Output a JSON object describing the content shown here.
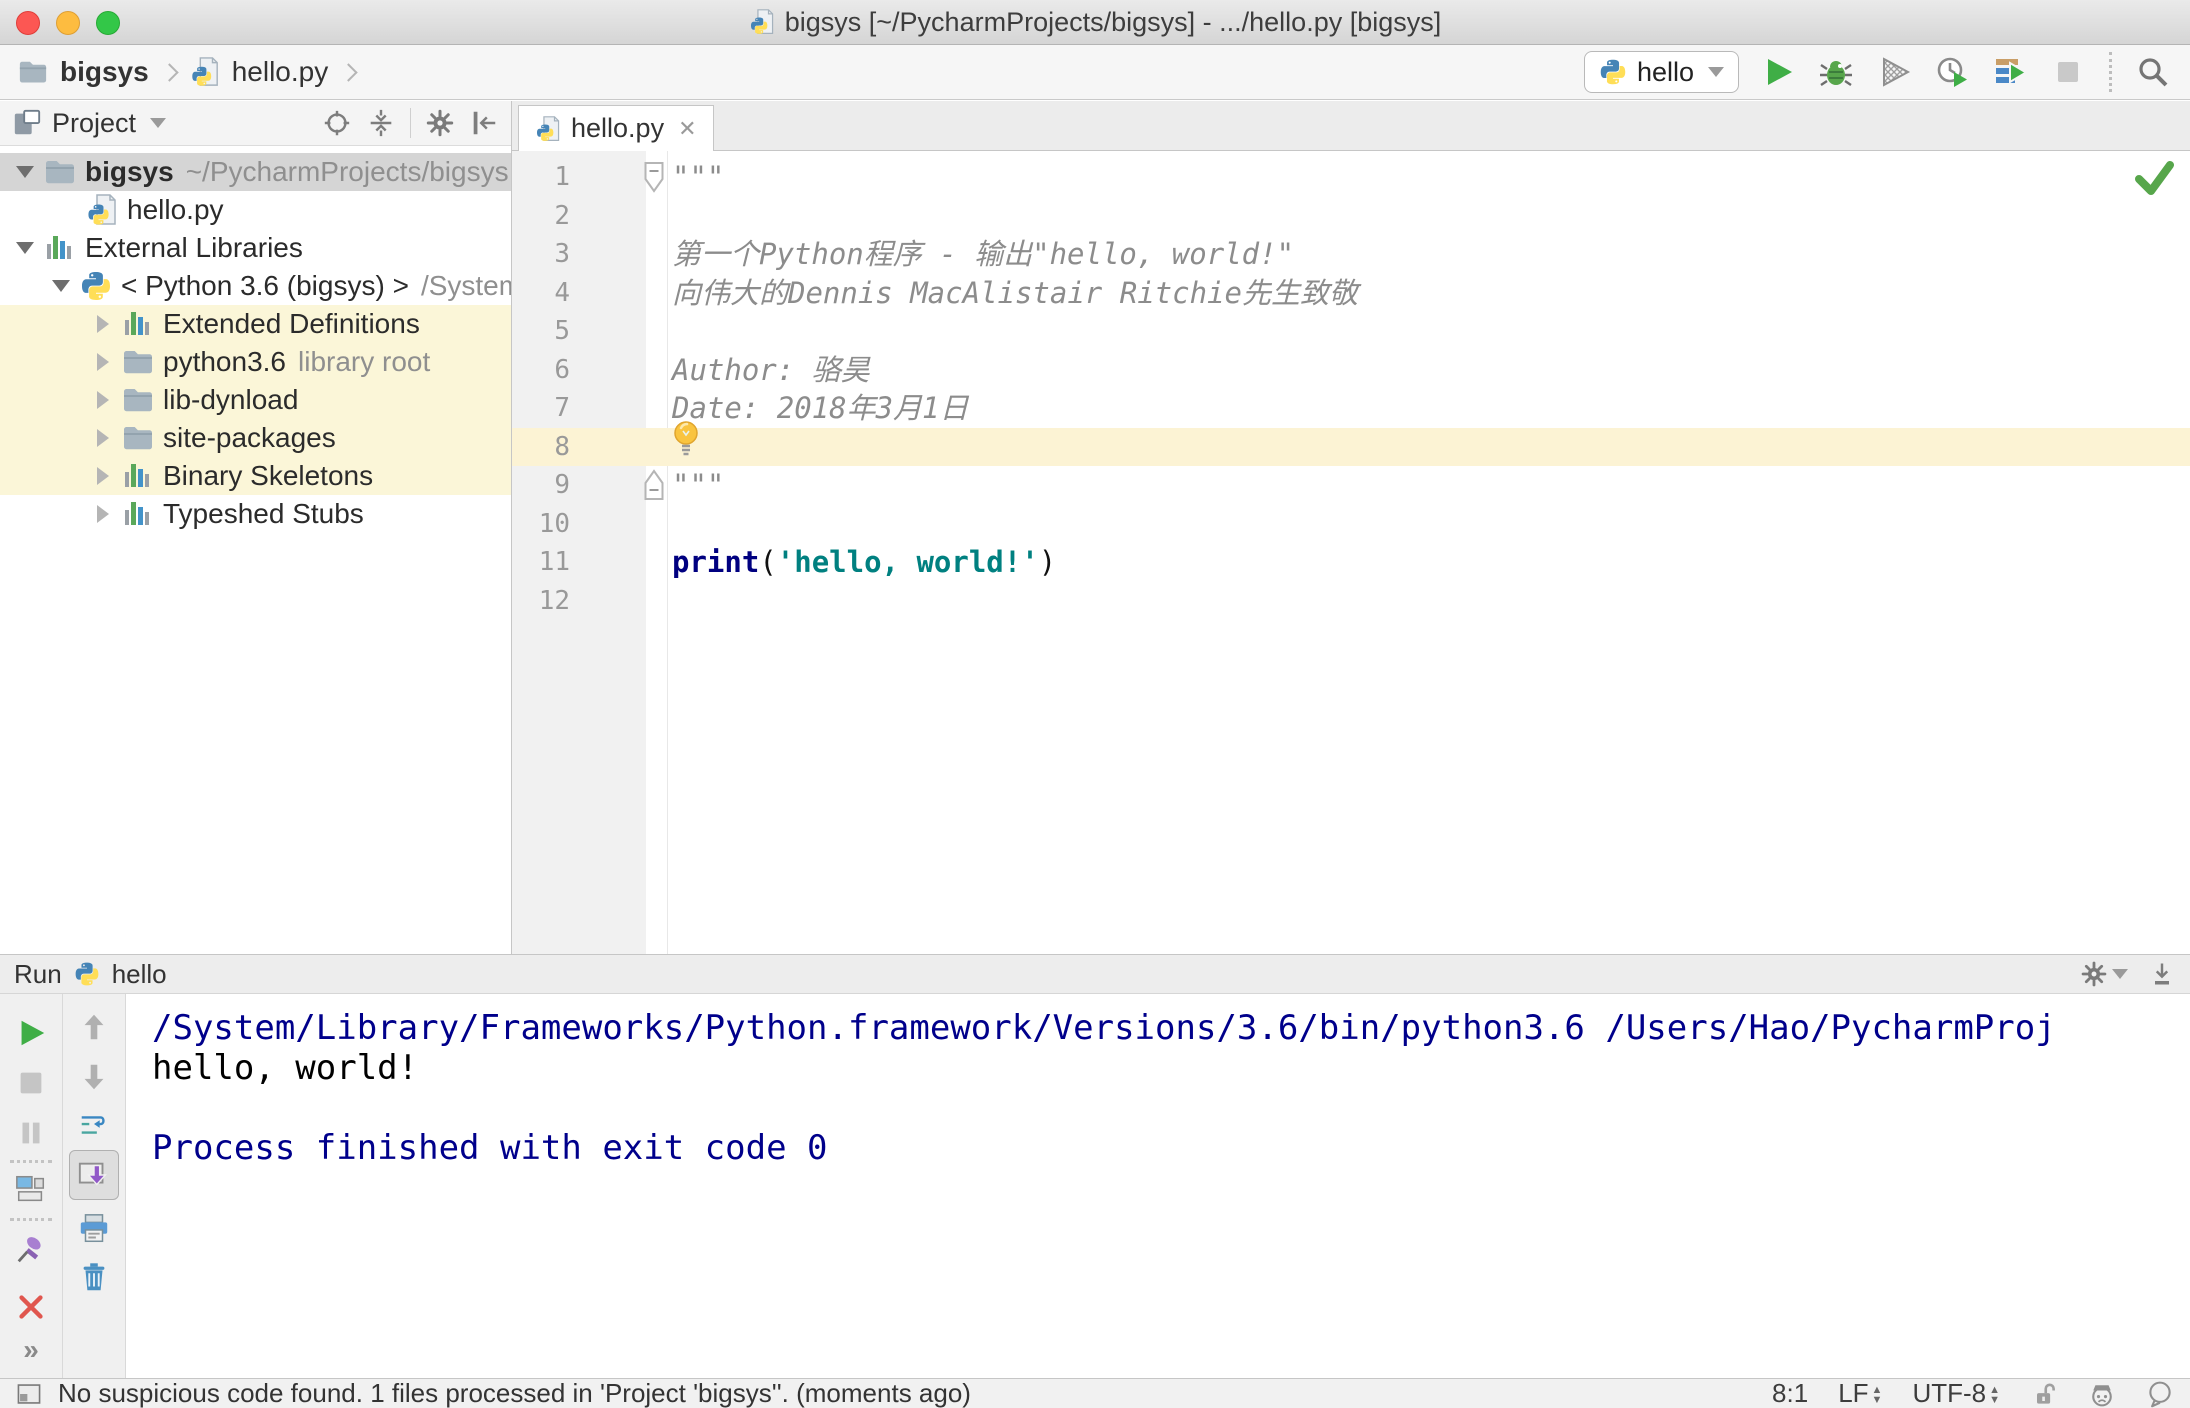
{
  "window": {
    "title": "bigsys [~/PycharmProjects/bigsys] - .../hello.py [bigsys]"
  },
  "navbar": {
    "breadcrumbs": {
      "project": "bigsys",
      "file": "hello.py"
    },
    "run_config": "hello",
    "toolbar_icons": [
      "run",
      "debug",
      "run-with-coverage",
      "profiler",
      "concurrency-diagram",
      "stop",
      "search-everywhere"
    ]
  },
  "project_panel": {
    "title": "Project",
    "toolbar_icons": [
      "locate",
      "collapse-all",
      "settings",
      "hide-panel"
    ],
    "tree": [
      {
        "label": "bigsys",
        "hint": "~/PycharmProjects/bigsys",
        "icon": "folder",
        "indent": "l0",
        "arrow": "expanded",
        "selected": true,
        "bold": true
      },
      {
        "label": "hello.py",
        "hint": "",
        "icon": "python-file",
        "indent": "file",
        "arrow": "none"
      },
      {
        "label": "External Libraries",
        "hint": "",
        "icon": "library",
        "indent": "l0",
        "arrow": "expanded"
      },
      {
        "label": "< Python 3.6 (bigsys) >",
        "hint": "/System",
        "icon": "python",
        "indent": "l1",
        "arrow": "expanded"
      },
      {
        "label": "Extended Definitions",
        "hint": "",
        "icon": "library",
        "indent": "l2",
        "arrow": "collapsed",
        "highlight": true
      },
      {
        "label": "python3.6",
        "hint": "library root",
        "icon": "folder",
        "indent": "l2",
        "arrow": "collapsed",
        "highlight": true
      },
      {
        "label": "lib-dynload",
        "hint": "",
        "icon": "folder",
        "indent": "l2",
        "arrow": "collapsed",
        "highlight": true
      },
      {
        "label": "site-packages",
        "hint": "",
        "icon": "folder",
        "indent": "l2",
        "arrow": "collapsed",
        "highlight": true
      },
      {
        "label": "Binary Skeletons",
        "hint": "",
        "icon": "library",
        "indent": "l2",
        "arrow": "collapsed",
        "highlight": true
      },
      {
        "label": "Typeshed Stubs",
        "hint": "",
        "icon": "library",
        "indent": "l2",
        "arrow": "collapsed"
      }
    ]
  },
  "editor": {
    "tab": {
      "title": "hello.py",
      "close_glyph": "✕"
    },
    "caret_line": 8,
    "bulb_line": 7,
    "inspection_status": "ok",
    "fold_markers": [
      {
        "line": 1,
        "direction": "down"
      },
      {
        "line": 9,
        "direction": "up"
      }
    ],
    "lines": [
      {
        "n": 1,
        "segments": [
          {
            "text": "\"\"\"",
            "style": "doc"
          }
        ]
      },
      {
        "n": 2,
        "segments": []
      },
      {
        "n": 3,
        "segments": [
          {
            "text": "第一个Python程序 - 输出\"hello, world!\"",
            "style": "doc"
          }
        ]
      },
      {
        "n": 4,
        "segments": [
          {
            "text": "向伟大的Dennis MacAlistair Ritchie先生致敬",
            "style": "doc"
          }
        ]
      },
      {
        "n": 5,
        "segments": []
      },
      {
        "n": 6,
        "segments": [
          {
            "text": "Author: 骆昊",
            "style": "doc"
          }
        ]
      },
      {
        "n": 7,
        "segments": [
          {
            "text": "Date: 2018年3月1日",
            "style": "doc"
          }
        ]
      },
      {
        "n": 8,
        "segments": []
      },
      {
        "n": 9,
        "segments": [
          {
            "text": "\"\"\"",
            "style": "doc"
          }
        ]
      },
      {
        "n": 10,
        "segments": []
      },
      {
        "n": 11,
        "segments": [
          {
            "text": "print",
            "style": "keyword"
          },
          {
            "text": "(",
            "style": "plain"
          },
          {
            "text": "'hello, world!'",
            "style": "string"
          },
          {
            "text": ")",
            "style": "plain"
          }
        ]
      },
      {
        "n": 12,
        "segments": []
      }
    ]
  },
  "run_panel": {
    "title": "Run",
    "tab": "hello",
    "left_toolbar_icons": [
      "rerun",
      "stop",
      "pause",
      "show-console",
      "pin",
      "close",
      "more"
    ],
    "inner_toolbar_icons": [
      "up",
      "down",
      "soft-wrap",
      "scroll-to-end",
      "print",
      "clear-all"
    ],
    "console": [
      {
        "text": "/System/Library/Frameworks/Python.framework/Versions/3.6/bin/python3.6 /Users/Hao/PycharmProj",
        "style": "system"
      },
      {
        "text": "hello, world!",
        "style": "stdout"
      },
      {
        "text": "",
        "style": "stdout"
      },
      {
        "text": "Process finished with exit code 0",
        "style": "system"
      }
    ],
    "more_glyph": "»"
  },
  "status_bar": {
    "message": "No suspicious code found. 1 files processed in 'Project 'bigsys''. (moments ago)",
    "caret_position": "8:1",
    "line_separator": "LF",
    "encoding": "UTF-8"
  },
  "colors": {
    "selection_gray": "#d5d5d5",
    "library_scope_yellow": "#fbf6d8",
    "caret_line_yellow": "#fcf3d4",
    "keyword": "#000080",
    "string": "#008080",
    "docstring": "#8c8c8c",
    "console_system": "#00008b",
    "run_green": "#3fae46"
  }
}
